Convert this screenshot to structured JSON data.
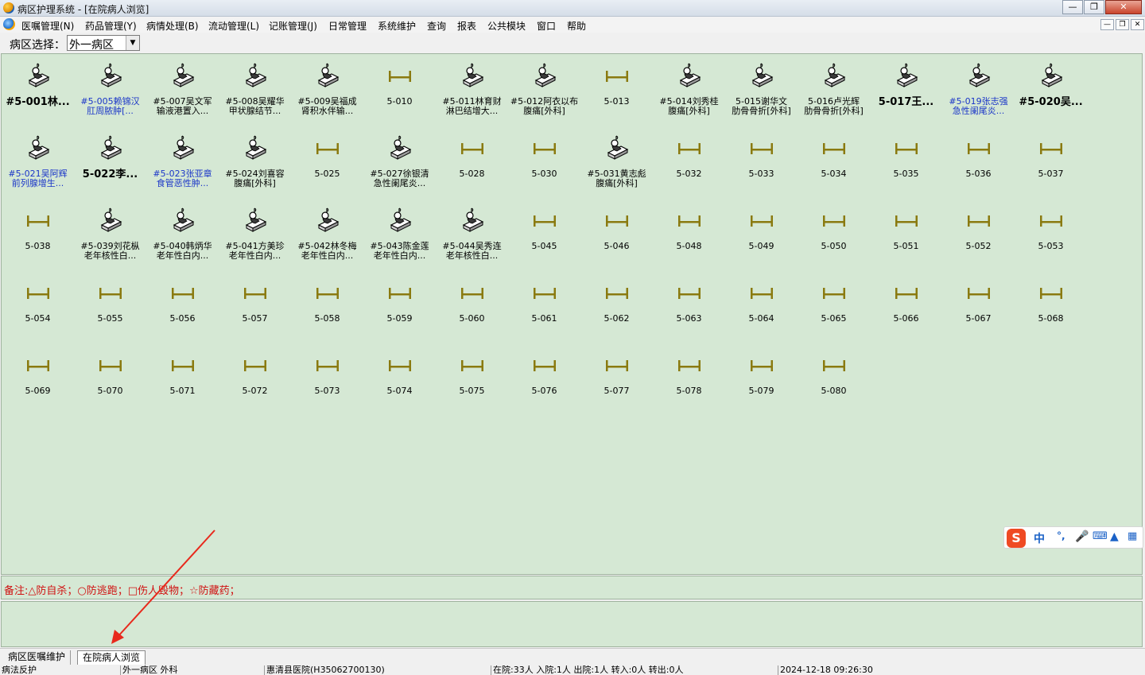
{
  "window": {
    "title": "病区护理系统 - [在院病人浏览]"
  },
  "menu": {
    "items": [
      "医嘱管理(N)",
      "药品管理(Y)",
      "病情处理(B)",
      "流动管理(L)",
      "记账管理(J)",
      "日常管理",
      "系统维护",
      "查询",
      "报表",
      "公共模块",
      "窗口",
      "帮助"
    ]
  },
  "ward": {
    "label": "病区选择：",
    "selected": "外一病区"
  },
  "beds": [
    {
      "line1": "#5-001林...",
      "line2": "",
      "state": "occupied",
      "style": "bold"
    },
    {
      "line1": "#5-005赖锦汉",
      "line2": "肛周脓肿[...",
      "state": "occupied",
      "style": "blue"
    },
    {
      "line1": "#5-007吴文军",
      "line2": "输液港置入...",
      "state": "occupied",
      "style": "normal"
    },
    {
      "line1": "#5-008吴耀华",
      "line2": "甲状腺结节...",
      "state": "occupied",
      "style": "normal"
    },
    {
      "line1": "#5-009吴福成",
      "line2": "肾积水伴输...",
      "state": "occupied",
      "style": "normal"
    },
    {
      "line1": "5-010",
      "line2": "",
      "state": "vacant",
      "style": "normal"
    },
    {
      "line1": "#5-011林育财",
      "line2": "淋巴结增大...",
      "state": "occupied",
      "style": "normal"
    },
    {
      "line1": "#5-012阿衣以布",
      "line2": "腹痛[外科]",
      "state": "occupied",
      "style": "normal"
    },
    {
      "line1": "5-013",
      "line2": "",
      "state": "vacant",
      "style": "normal"
    },
    {
      "line1": "#5-014刘秀桂",
      "line2": "腹痛[外科]",
      "state": "occupied",
      "style": "normal"
    },
    {
      "line1": "5-015谢华文",
      "line2": "肋骨骨折[外科]",
      "state": "occupied",
      "style": "normal"
    },
    {
      "line1": "5-016卢光辉",
      "line2": "肋骨骨折[外科]",
      "state": "occupied",
      "style": "normal"
    },
    {
      "line1": "5-017王...",
      "line2": "",
      "state": "occupied",
      "style": "bold"
    },
    {
      "line1": "#5-019张志强",
      "line2": "急性阑尾炎...",
      "state": "occupied",
      "style": "blue"
    },
    {
      "line1": "#5-020吴...",
      "line2": "",
      "state": "occupied",
      "style": "bold"
    },
    {
      "line1": "#5-021吴阿辉",
      "line2": "前列腺增生...",
      "state": "occupied",
      "style": "blue"
    },
    {
      "line1": "5-022李...",
      "line2": "",
      "state": "occupied",
      "style": "bold"
    },
    {
      "line1": "#5-023张亚章",
      "line2": "食管恶性肿...",
      "state": "occupied",
      "style": "blue"
    },
    {
      "line1": "#5-024刘喜容",
      "line2": "腹痛[外科]",
      "state": "occupied",
      "style": "normal"
    },
    {
      "line1": "5-025",
      "line2": "",
      "state": "vacant",
      "style": "normal"
    },
    {
      "line1": "#5-027徐银清",
      "line2": "急性阑尾炎...",
      "state": "occupied",
      "style": "normal"
    },
    {
      "line1": "5-028",
      "line2": "",
      "state": "vacant",
      "style": "normal"
    },
    {
      "line1": "5-030",
      "line2": "",
      "state": "vacant",
      "style": "normal"
    },
    {
      "line1": "#5-031黄志彪",
      "line2": "腹痛[外科]",
      "state": "occupied",
      "style": "normal"
    },
    {
      "line1": "5-032",
      "line2": "",
      "state": "vacant",
      "style": "normal"
    },
    {
      "line1": "5-033",
      "line2": "",
      "state": "vacant",
      "style": "normal"
    },
    {
      "line1": "5-034",
      "line2": "",
      "state": "vacant",
      "style": "normal"
    },
    {
      "line1": "5-035",
      "line2": "",
      "state": "vacant",
      "style": "normal"
    },
    {
      "line1": "5-036",
      "line2": "",
      "state": "vacant",
      "style": "normal"
    },
    {
      "line1": "5-037",
      "line2": "",
      "state": "vacant",
      "style": "normal"
    },
    {
      "line1": "5-038",
      "line2": "",
      "state": "vacant",
      "style": "normal"
    },
    {
      "line1": "#5-039刘花枞",
      "line2": "老年核性白...",
      "state": "occupied",
      "style": "normal"
    },
    {
      "line1": "#5-040韩炳华",
      "line2": "老年性白内...",
      "state": "occupied",
      "style": "normal"
    },
    {
      "line1": "#5-041方美珍",
      "line2": "老年性白内...",
      "state": "occupied",
      "style": "normal"
    },
    {
      "line1": "#5-042林冬梅",
      "line2": "老年性白内...",
      "state": "occupied",
      "style": "normal"
    },
    {
      "line1": "#5-043陈金莲",
      "line2": "老年性白内...",
      "state": "occupied",
      "style": "normal"
    },
    {
      "line1": "#5-044吴秀连",
      "line2": "老年核性白...",
      "state": "occupied",
      "style": "normal"
    },
    {
      "line1": "5-045",
      "line2": "",
      "state": "vacant",
      "style": "normal"
    },
    {
      "line1": "5-046",
      "line2": "",
      "state": "vacant",
      "style": "normal"
    },
    {
      "line1": "5-048",
      "line2": "",
      "state": "vacant",
      "style": "normal"
    },
    {
      "line1": "5-049",
      "line2": "",
      "state": "vacant",
      "style": "normal"
    },
    {
      "line1": "5-050",
      "line2": "",
      "state": "vacant",
      "style": "normal"
    },
    {
      "line1": "5-051",
      "line2": "",
      "state": "vacant",
      "style": "normal"
    },
    {
      "line1": "5-052",
      "line2": "",
      "state": "vacant",
      "style": "normal"
    },
    {
      "line1": "5-053",
      "line2": "",
      "state": "vacant",
      "style": "normal"
    },
    {
      "line1": "5-054",
      "line2": "",
      "state": "vacant",
      "style": "normal"
    },
    {
      "line1": "5-055",
      "line2": "",
      "state": "vacant",
      "style": "normal"
    },
    {
      "line1": "5-056",
      "line2": "",
      "state": "vacant",
      "style": "normal"
    },
    {
      "line1": "5-057",
      "line2": "",
      "state": "vacant",
      "style": "normal"
    },
    {
      "line1": "5-058",
      "line2": "",
      "state": "vacant",
      "style": "normal"
    },
    {
      "line1": "5-059",
      "line2": "",
      "state": "vacant",
      "style": "normal"
    },
    {
      "line1": "5-060",
      "line2": "",
      "state": "vacant",
      "style": "normal"
    },
    {
      "line1": "5-061",
      "line2": "",
      "state": "vacant",
      "style": "normal"
    },
    {
      "line1": "5-062",
      "line2": "",
      "state": "vacant",
      "style": "normal"
    },
    {
      "line1": "5-063",
      "line2": "",
      "state": "vacant",
      "style": "normal"
    },
    {
      "line1": "5-064",
      "line2": "",
      "state": "vacant",
      "style": "normal"
    },
    {
      "line1": "5-065",
      "line2": "",
      "state": "vacant",
      "style": "normal"
    },
    {
      "line1": "5-066",
      "line2": "",
      "state": "vacant",
      "style": "normal"
    },
    {
      "line1": "5-067",
      "line2": "",
      "state": "vacant",
      "style": "normal"
    },
    {
      "line1": "5-068",
      "line2": "",
      "state": "vacant",
      "style": "normal"
    },
    {
      "line1": "5-069",
      "line2": "",
      "state": "vacant",
      "style": "normal"
    },
    {
      "line1": "5-070",
      "line2": "",
      "state": "vacant",
      "style": "normal"
    },
    {
      "line1": "5-071",
      "line2": "",
      "state": "vacant",
      "style": "normal"
    },
    {
      "line1": "5-072",
      "line2": "",
      "state": "vacant",
      "style": "normal"
    },
    {
      "line1": "5-073",
      "line2": "",
      "state": "vacant",
      "style": "normal"
    },
    {
      "line1": "5-074",
      "line2": "",
      "state": "vacant",
      "style": "normal"
    },
    {
      "line1": "5-075",
      "line2": "",
      "state": "vacant",
      "style": "normal"
    },
    {
      "line1": "5-076",
      "line2": "",
      "state": "vacant",
      "style": "normal"
    },
    {
      "line1": "5-077",
      "line2": "",
      "state": "vacant",
      "style": "normal"
    },
    {
      "line1": "5-078",
      "line2": "",
      "state": "vacant",
      "style": "normal"
    },
    {
      "line1": "5-079",
      "line2": "",
      "state": "vacant",
      "style": "normal"
    },
    {
      "line1": "5-080",
      "line2": "",
      "state": "vacant",
      "style": "normal"
    }
  ],
  "note": {
    "text": "备注:△防自杀；○防逃跑；□伤人毁物；☆防藏药；"
  },
  "tabs": [
    {
      "label": "病区医嘱维护",
      "active": false
    },
    {
      "label": "在院病人浏览",
      "active": true
    }
  ],
  "status": [
    "病法反护",
    "外一病区 外科",
    "惠清县医院(H35062700130)",
    "在院:33人 入院:1人 出院:1人 转入:0人 转出:0人",
    "2024-12-18 09:26:30"
  ],
  "ime": {
    "mode": "中",
    "punct": "°,"
  },
  "colors": {
    "panel": "#d5e8d4",
    "vacant_bed": "#8a7a10",
    "blue_text": "#1a35c8",
    "note_text": "#d01010",
    "arrow": "#e8291c"
  }
}
